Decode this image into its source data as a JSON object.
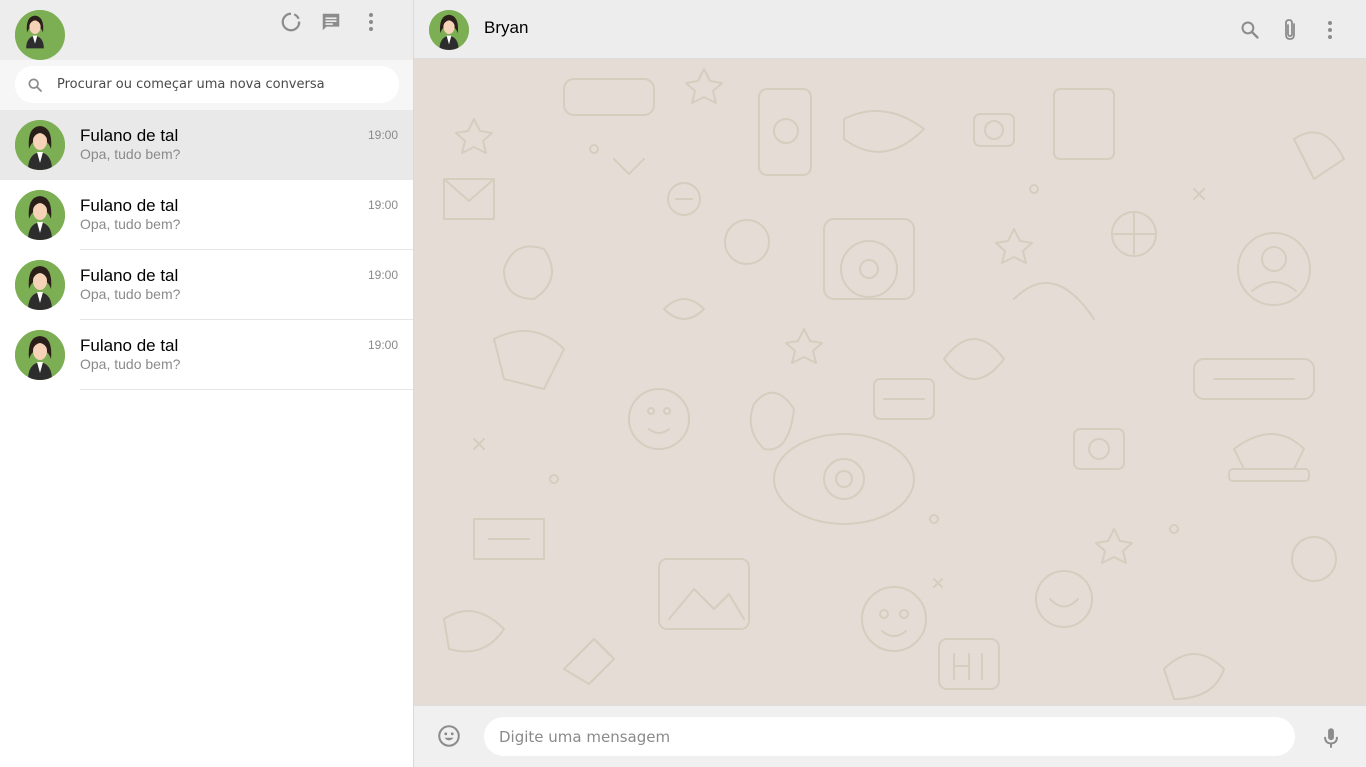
{
  "sidebar": {
    "header": {
      "icons": [
        "avatar",
        "status-icon",
        "new-chat-icon",
        "menu-icon"
      ]
    },
    "search": {
      "placeholder": "Procurar ou começar uma nova conversa"
    },
    "chats": [
      {
        "name": "Fulano de tal",
        "time": "19:00",
        "last_message": "Opa, tudo bem?",
        "active": true
      },
      {
        "name": "Fulano de tal",
        "time": "19:00",
        "last_message": "Opa, tudo bem?",
        "active": false
      },
      {
        "name": "Fulano de tal",
        "time": "19:00",
        "last_message": "Opa, tudo bem?",
        "active": false
      },
      {
        "name": "Fulano de tal",
        "time": "19:00",
        "last_message": "Opa, tudo bem?",
        "active": false
      }
    ]
  },
  "main": {
    "header": {
      "contact_name": "Bryan",
      "icons": [
        "search-icon",
        "attach-icon",
        "menu-icon"
      ]
    },
    "composer": {
      "placeholder": "Digite uma mensagem",
      "icons": [
        "emoji-icon",
        "mic-icon"
      ]
    }
  },
  "colors": {
    "header_bg": "#ededed",
    "wallpaper_bg": "#e5ddd5",
    "active_chat_bg": "#e9e9e9",
    "avatar_bg": "#7cae54",
    "icon_gray": "#8c8c8c"
  }
}
